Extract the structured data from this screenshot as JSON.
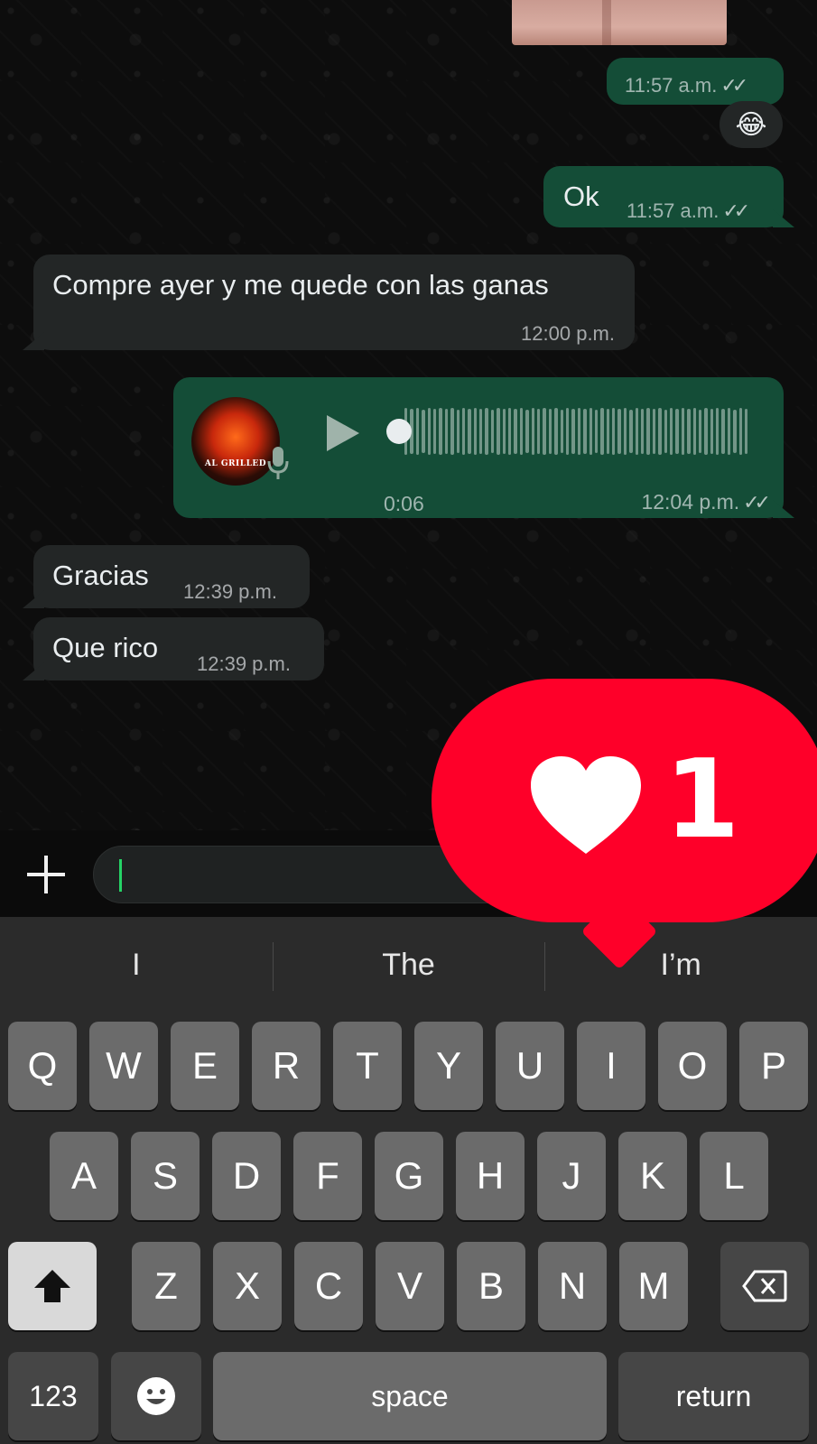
{
  "chat": {
    "messages": [
      {
        "type": "outgoing",
        "time": "11:57 a.m."
      },
      {
        "type": "reaction",
        "emoji": "😂"
      },
      {
        "type": "outgoing",
        "text": "Ok",
        "time": "11:57 a.m."
      },
      {
        "type": "incoming",
        "text": "Compre ayer y me quede con las ganas",
        "time": "12:00 p.m."
      },
      {
        "type": "outgoing-audio",
        "duration": "0:06",
        "time": "12:04 p.m.",
        "avatar_label": "AL GRILLED"
      },
      {
        "type": "incoming",
        "text": "Gracias",
        "time": "12:39 p.m."
      },
      {
        "type": "incoming",
        "text": "Que rico",
        "time": "12:39 p.m."
      }
    ]
  },
  "notification": {
    "count": "1",
    "icon": "heart-icon",
    "color": "#fe0029"
  },
  "keyboard": {
    "suggestions": [
      "I",
      "The",
      "I’m"
    ],
    "row1": [
      "Q",
      "W",
      "E",
      "R",
      "T",
      "Y",
      "U",
      "I",
      "O",
      "P"
    ],
    "row2": [
      "A",
      "S",
      "D",
      "F",
      "G",
      "H",
      "J",
      "K",
      "L"
    ],
    "row3": [
      "Z",
      "X",
      "C",
      "V",
      "B",
      "N",
      "M"
    ],
    "numbers_label": "123",
    "space_label": "space",
    "return_label": "return"
  }
}
